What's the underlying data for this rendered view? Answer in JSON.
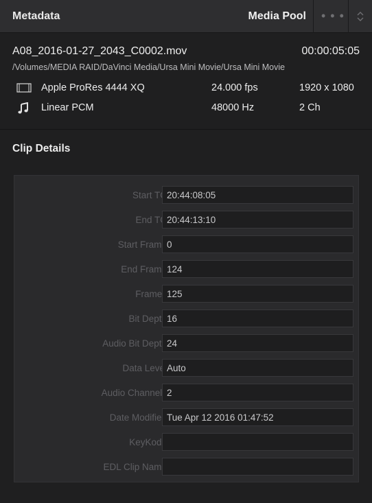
{
  "header": {
    "title": "Metadata",
    "media_pool_label": "Media Pool",
    "more_label": "• • •"
  },
  "file": {
    "name": "A08_2016-01-27_2043_C0002.mov",
    "duration": "00:00:05:05",
    "path": "/Volumes/MEDIA RAID/DaVinci Media/Ursa Mini Movie/Ursa Mini Movie"
  },
  "video": {
    "icon": "film-icon",
    "codec": "Apple ProRes 4444 XQ",
    "fps": "24.000 fps",
    "resolution": "1920 x 1080"
  },
  "audio": {
    "icon": "music-note-icon",
    "codec": "Linear PCM",
    "sample_rate": "48000 Hz",
    "channels": "2 Ch"
  },
  "clip_details": {
    "title": "Clip Details",
    "fields": [
      {
        "label": "Start TC",
        "value": "20:44:08:05"
      },
      {
        "label": "End TC",
        "value": "20:44:13:10"
      },
      {
        "label": "Start Frame",
        "value": "0"
      },
      {
        "label": "End Frame",
        "value": "124"
      },
      {
        "label": "Frames",
        "value": "125"
      },
      {
        "label": "Bit Depth",
        "value": "16"
      },
      {
        "label": "Audio Bit Depth",
        "value": "24"
      },
      {
        "label": "Data Level",
        "value": "Auto"
      },
      {
        "label": "Audio Channels",
        "value": "2"
      },
      {
        "label": "Date Modified",
        "value": "Tue Apr 12 2016 01:47:52"
      },
      {
        "label": "KeyKode",
        "value": ""
      },
      {
        "label": "EDL Clip Name",
        "value": ""
      }
    ]
  }
}
